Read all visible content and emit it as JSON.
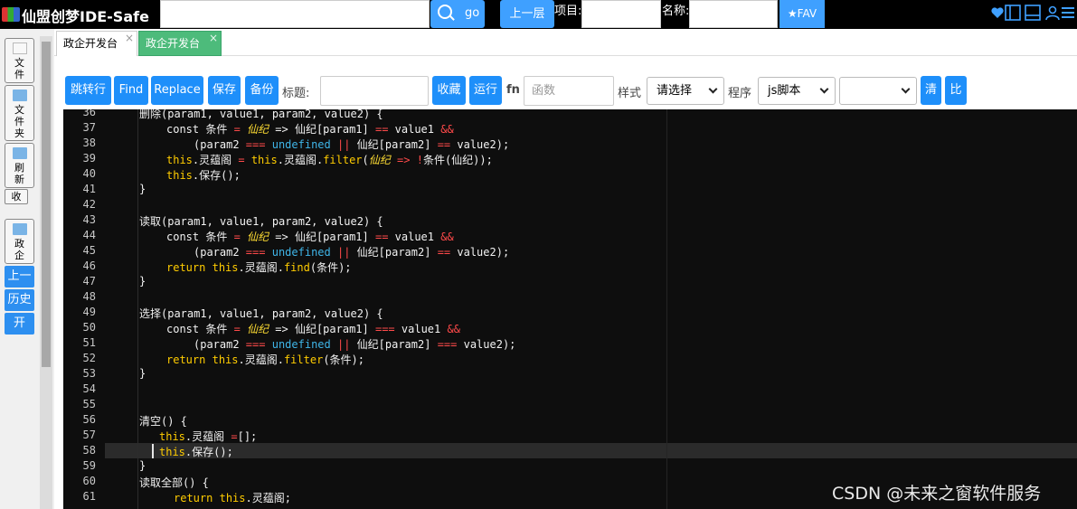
{
  "header": {
    "title": "仙盟创梦IDE-Safe",
    "go_label": "go",
    "up_label": "上一层",
    "project_label": "项目:",
    "name_label": "名称:",
    "fav_label": "★FAV"
  },
  "sidebar": {
    "file": "文件",
    "folder": "文件夹",
    "refresh": "刷新",
    "collapse": "收",
    "project": "政企",
    "up": "上一",
    "history": "历史",
    "open": "开"
  },
  "tabs": [
    {
      "label": "政企开发台",
      "close": "×"
    },
    {
      "label": "政企开发台",
      "close": "×"
    }
  ],
  "toolbar": {
    "jump": "跳转行",
    "find": "Find",
    "replace": "Replace",
    "save": "保存",
    "backup": "备份",
    "title_label": "标题:",
    "collect": "收藏",
    "run": "运行",
    "fn_label": "fn",
    "fn_placeholder": "函数",
    "style_label": "样式",
    "style_value": "请选择",
    "program_label": "程序",
    "program_value": "js脚本",
    "clear": "清",
    "compare": "比"
  },
  "editor": {
    "line_numbers": [
      "36",
      "37",
      "38",
      "39",
      "40",
      "41",
      "42",
      "43",
      "44",
      "45",
      "46",
      "47",
      "48",
      "49",
      "50",
      "51",
      "52",
      "53",
      "54",
      "55",
      "56",
      "57",
      "58",
      "59",
      "60",
      "61"
    ],
    "lines": [
      {
        "indent": 84,
        "parts": [
          {
            "c": "pl",
            "t": "删除(param1, value1, param2, value2) {"
          }
        ]
      },
      {
        "indent": 114,
        "parts": [
          {
            "c": "pl",
            "t": "const 条件 "
          },
          {
            "c": "op",
            "t": "="
          },
          {
            "c": "pl",
            "t": " "
          },
          {
            "c": "it",
            "t": "仙纪"
          },
          {
            "c": "pl",
            "t": " => 仙纪[param1] "
          },
          {
            "c": "op",
            "t": "=="
          },
          {
            "c": "pl",
            "t": " value1 "
          },
          {
            "c": "op",
            "t": "&&"
          }
        ]
      },
      {
        "indent": 144,
        "parts": [
          {
            "c": "pl",
            "t": "(param2 "
          },
          {
            "c": "op",
            "t": "==="
          },
          {
            "c": "pl",
            "t": " "
          },
          {
            "c": "ud",
            "t": "undefined"
          },
          {
            "c": "pl",
            "t": " "
          },
          {
            "c": "op",
            "t": "||"
          },
          {
            "c": "pl",
            "t": " 仙纪[param2] "
          },
          {
            "c": "op",
            "t": "=="
          },
          {
            "c": "pl",
            "t": " value2);"
          }
        ]
      },
      {
        "indent": 114,
        "parts": [
          {
            "c": "kw",
            "t": "this"
          },
          {
            "c": "pl",
            "t": ".灵蕴阁 "
          },
          {
            "c": "op",
            "t": "="
          },
          {
            "c": "pl",
            "t": " "
          },
          {
            "c": "kw",
            "t": "this"
          },
          {
            "c": "pl",
            "t": ".灵蕴阁."
          },
          {
            "c": "kw",
            "t": "filter"
          },
          {
            "c": "pl",
            "t": "("
          },
          {
            "c": "it",
            "t": "仙纪"
          },
          {
            "c": "pl",
            "t": " "
          },
          {
            "c": "op",
            "t": "=>"
          },
          {
            "c": "pl",
            "t": " "
          },
          {
            "c": "op",
            "t": "!"
          },
          {
            "c": "pl",
            "t": "条件(仙纪));"
          }
        ]
      },
      {
        "indent": 114,
        "parts": [
          {
            "c": "kw",
            "t": "this"
          },
          {
            "c": "pl",
            "t": ".保存();"
          }
        ]
      },
      {
        "indent": 84,
        "parts": [
          {
            "c": "pl",
            "t": "}"
          }
        ]
      },
      {
        "indent": 84,
        "parts": []
      },
      {
        "indent": 84,
        "parts": [
          {
            "c": "pl",
            "t": "读取(param1, value1, param2, value2) {"
          }
        ]
      },
      {
        "indent": 114,
        "parts": [
          {
            "c": "pl",
            "t": "const 条件 "
          },
          {
            "c": "op",
            "t": "="
          },
          {
            "c": "pl",
            "t": " "
          },
          {
            "c": "it",
            "t": "仙纪"
          },
          {
            "c": "pl",
            "t": " => 仙纪[param1] "
          },
          {
            "c": "op",
            "t": "=="
          },
          {
            "c": "pl",
            "t": " value1 "
          },
          {
            "c": "op",
            "t": "&&"
          }
        ]
      },
      {
        "indent": 144,
        "parts": [
          {
            "c": "pl",
            "t": "(param2 "
          },
          {
            "c": "op",
            "t": "==="
          },
          {
            "c": "pl",
            "t": " "
          },
          {
            "c": "ud",
            "t": "undefined"
          },
          {
            "c": "pl",
            "t": " "
          },
          {
            "c": "op",
            "t": "||"
          },
          {
            "c": "pl",
            "t": " 仙纪[param2] "
          },
          {
            "c": "op",
            "t": "=="
          },
          {
            "c": "pl",
            "t": " value2);"
          }
        ]
      },
      {
        "indent": 114,
        "parts": [
          {
            "c": "kw",
            "t": "return"
          },
          {
            "c": "pl",
            "t": " "
          },
          {
            "c": "kw",
            "t": "this"
          },
          {
            "c": "pl",
            "t": ".灵蕴阁."
          },
          {
            "c": "kw",
            "t": "find"
          },
          {
            "c": "pl",
            "t": "(条件);"
          }
        ]
      },
      {
        "indent": 84,
        "parts": [
          {
            "c": "pl",
            "t": "}"
          }
        ]
      },
      {
        "indent": 84,
        "parts": []
      },
      {
        "indent": 84,
        "parts": [
          {
            "c": "pl",
            "t": "选择(param1, value1, param2, value2) {"
          }
        ]
      },
      {
        "indent": 114,
        "parts": [
          {
            "c": "pl",
            "t": "const 条件 "
          },
          {
            "c": "op",
            "t": "="
          },
          {
            "c": "pl",
            "t": " "
          },
          {
            "c": "it",
            "t": "仙纪"
          },
          {
            "c": "pl",
            "t": " => 仙纪[param1] "
          },
          {
            "c": "op",
            "t": "==="
          },
          {
            "c": "pl",
            "t": " value1 "
          },
          {
            "c": "op",
            "t": "&&"
          }
        ]
      },
      {
        "indent": 144,
        "parts": [
          {
            "c": "pl",
            "t": "(param2 "
          },
          {
            "c": "op",
            "t": "==="
          },
          {
            "c": "pl",
            "t": " "
          },
          {
            "c": "ud",
            "t": "undefined"
          },
          {
            "c": "pl",
            "t": " "
          },
          {
            "c": "op",
            "t": "||"
          },
          {
            "c": "pl",
            "t": " 仙纪[param2] "
          },
          {
            "c": "op",
            "t": "==="
          },
          {
            "c": "pl",
            "t": " value2);"
          }
        ]
      },
      {
        "indent": 114,
        "parts": [
          {
            "c": "kw",
            "t": "return"
          },
          {
            "c": "pl",
            "t": " "
          },
          {
            "c": "kw",
            "t": "this"
          },
          {
            "c": "pl",
            "t": ".灵蕴阁."
          },
          {
            "c": "kw",
            "t": "filter"
          },
          {
            "c": "pl",
            "t": "(条件);"
          }
        ]
      },
      {
        "indent": 84,
        "parts": [
          {
            "c": "pl",
            "t": "}"
          }
        ]
      },
      {
        "indent": 84,
        "parts": []
      },
      {
        "indent": 84,
        "parts": []
      },
      {
        "indent": 84,
        "parts": [
          {
            "c": "pl",
            "t": "清空() {"
          }
        ]
      },
      {
        "indent": 106,
        "parts": [
          {
            "c": "kw",
            "t": "this"
          },
          {
            "c": "pl",
            "t": ".灵蕴阁 "
          },
          {
            "c": "op",
            "t": "="
          },
          {
            "c": "pl",
            "t": "[];"
          }
        ]
      },
      {
        "indent": 106,
        "parts": [
          {
            "c": "kw",
            "t": "this"
          },
          {
            "c": "pl",
            "t": ".保存();"
          }
        ]
      },
      {
        "indent": 84,
        "parts": [
          {
            "c": "pl",
            "t": "}"
          }
        ]
      },
      {
        "indent": 84,
        "parts": [
          {
            "c": "pl",
            "t": "读取全部() {"
          }
        ]
      },
      {
        "indent": 122,
        "parts": [
          {
            "c": "kw",
            "t": "return"
          },
          {
            "c": "pl",
            "t": " "
          },
          {
            "c": "kw",
            "t": "this"
          },
          {
            "c": "pl",
            "t": ".灵蕴阁;"
          }
        ]
      }
    ]
  },
  "watermark": "CSDN @未来之窗软件服务"
}
